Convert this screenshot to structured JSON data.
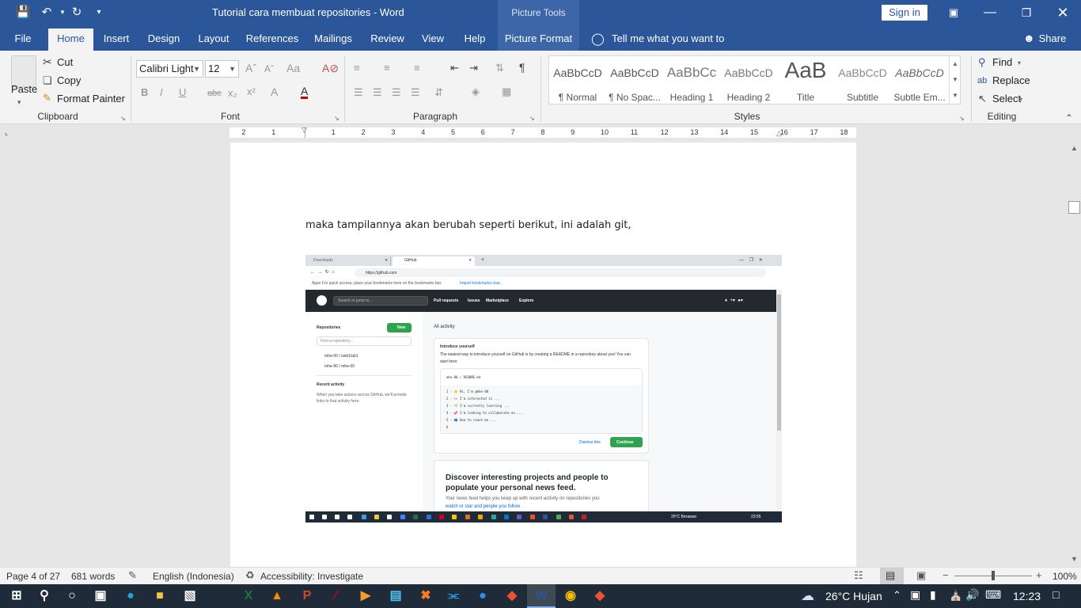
{
  "window": {
    "title": "Tutorial cara membuat repositories  -  Word",
    "context_tab": "Picture Tools",
    "sign_in": "Sign in"
  },
  "tabs": [
    "File",
    "Home",
    "Insert",
    "Design",
    "Layout",
    "References",
    "Mailings",
    "Review",
    "View",
    "Help",
    "Picture Format"
  ],
  "tell_me": "Tell me what you want to do",
  "share": "Share",
  "clipboard": {
    "paste": "Paste",
    "cut": "Cut",
    "copy": "Copy",
    "format_painter": "Format Painter",
    "label": "Clipboard"
  },
  "font": {
    "name": "Calibri Light",
    "size": "12",
    "label": "Font"
  },
  "paragraph": {
    "label": "Paragraph"
  },
  "styles": {
    "label": "Styles",
    "items": [
      {
        "preview": "AaBbCcD",
        "name": "¶ Normal"
      },
      {
        "preview": "AaBbCcD",
        "name": "¶ No Spac..."
      },
      {
        "preview": "AaBbCc",
        "name": "Heading 1"
      },
      {
        "preview": "AaBbCcD",
        "name": "Heading 2"
      },
      {
        "preview": "AaB",
        "name": "Title"
      },
      {
        "preview": "AaBbCcD",
        "name": "Subtitle"
      },
      {
        "preview": "AaBbCcD",
        "name": "Subtle Em..."
      }
    ]
  },
  "editing": {
    "find": "Find",
    "replace": "Replace",
    "select": "Select",
    "label": "Editing"
  },
  "ruler": {
    "marks": [
      "2",
      "1",
      "1",
      "2",
      "3",
      "4",
      "5",
      "6",
      "7",
      "8",
      "9",
      "10",
      "11",
      "12",
      "13",
      "14",
      "15",
      "16",
      "17",
      "18"
    ]
  },
  "document": {
    "paragraph": "maka tampilannya akan berubah seperti berikut, ini adalah git,"
  },
  "embedded_screenshot": {
    "tab1": "Downloads",
    "tab2": "GitHub",
    "url": "https://github.com",
    "bookmarks": "Apps    For quick access, place your bookmarks here on the bookmarks bar.",
    "bookmarks_link": "Import bookmarks now...",
    "search": "Search or jump to...",
    "nav": [
      "Pull requests",
      "Issues",
      "Marketplace",
      "Explore"
    ],
    "repositories": "Repositories",
    "new": "New",
    "find_repo": "Find a repository...",
    "repos": [
      "mhe-00 / web1lab1",
      "mhe-90 / mhe-00"
    ],
    "recent_activity": "Recent activity",
    "recent_text": "When you take actions across GitHub, we'll provide links to that activity here.",
    "all_activity": "All activity",
    "intro_title": "Introduce yourself",
    "intro_text": "The easiest way to introduce yourself on GitHub is by creating a README in a repository about you! You can start here:",
    "readme_path": "mhe-00 / README.md",
    "code_lines": [
      "1 - 👋 Hi, I'm @mhe-00",
      "2 - 👀 I'm interested in ...",
      "3 - 🌱 I'm currently learning ...",
      "4 - 💞 I'm looking to collaborate on ...",
      "5 - 📫 How to reach me ...",
      "6"
    ],
    "dismiss": "Dismiss this",
    "continue": "Continue",
    "discover_title": "Discover interesting projects and people to populate your personal news feed.",
    "discover_text": "Your news feed helps you keep up with recent activity on repositories you",
    "discover_links": "watch or star and people you follow.",
    "tray": "26°C  Berawan",
    "tray_time": "23:55"
  },
  "status": {
    "page": "Page 4 of 27",
    "words": "681 words",
    "language": "English (Indonesia)",
    "accessibility": "Accessibility: Investigate",
    "zoom": "100%"
  },
  "taskbar": {
    "weather": "26°C  Hujan",
    "time": "12:23"
  },
  "colors": {
    "word_blue": "#2b579a",
    "taskbar": "#1f2b38",
    "github_dark": "#24292e",
    "github_green": "#2ea44f"
  }
}
